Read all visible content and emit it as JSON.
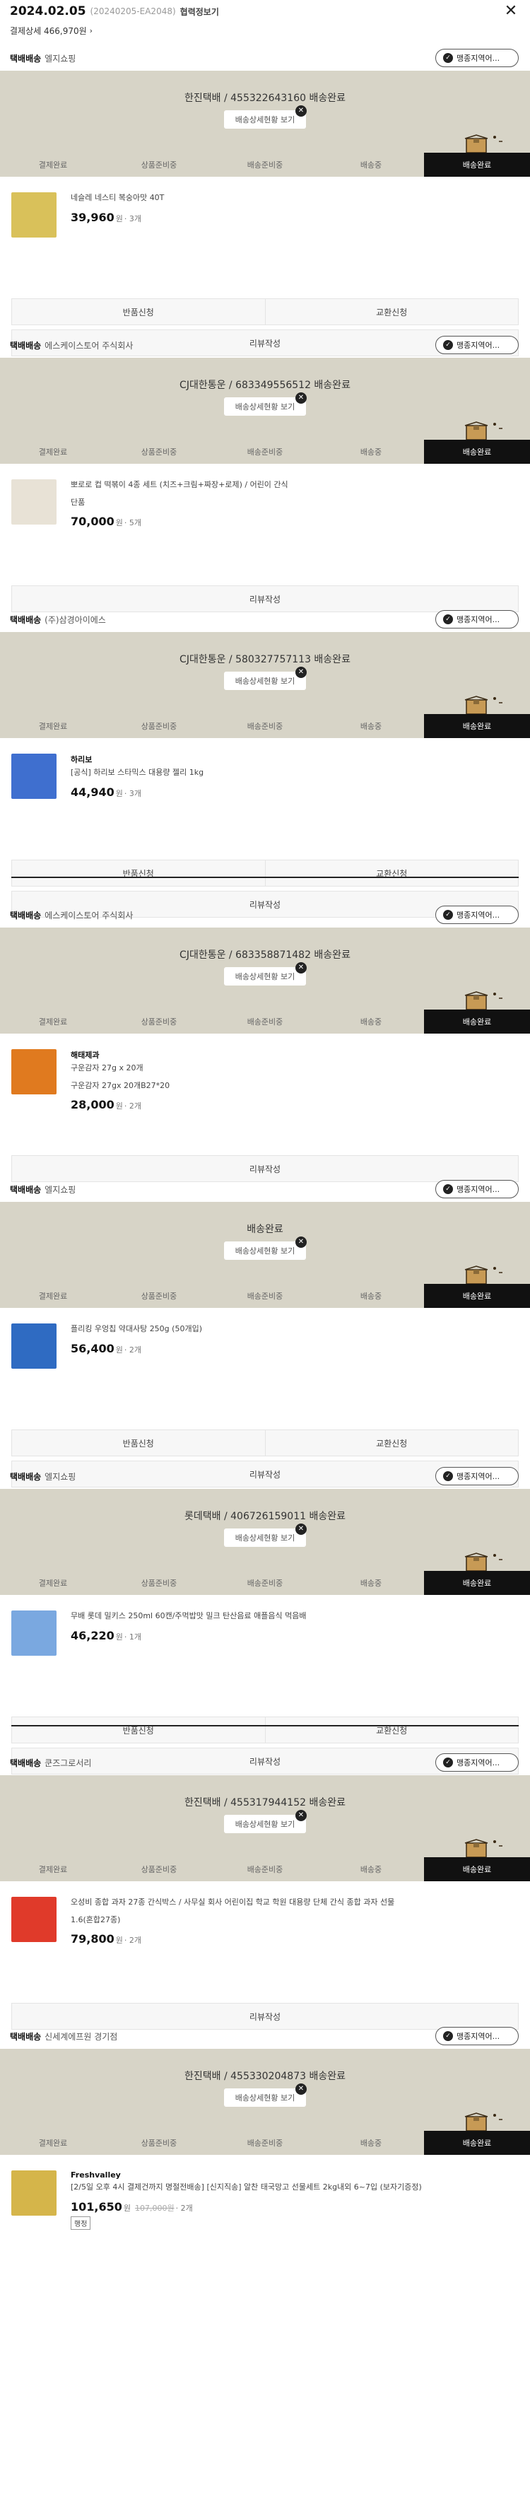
{
  "header": {
    "date": "2024.02.05",
    "order_no": "(20240205-EA2048)",
    "cert_label": "협력정보기",
    "close_icon": "✕",
    "sub_label": "결제상세 466,970원",
    "sub_chevron": "›"
  },
  "common": {
    "track_label": "배송상세현황 보기",
    "brand_label": "맹종지역어...",
    "won": "원",
    "sep": " · ",
    "steps": [
      "결제완료",
      "상품준비중",
      "배송준비중",
      "배송중",
      "배송완료"
    ]
  },
  "sections": [
    {
      "type": "택배배송",
      "seller": "엘지쇼핑",
      "carrier": "한진택배 / 455322643160 배송완료",
      "product": {
        "brand": "",
        "name": "네슬레 네스티 복숭아맛 40T",
        "option": "",
        "price": "39,960",
        "qty": "3개",
        "strike": "",
        "badge": ""
      },
      "actions": [
        [
          "반품신청",
          "교환신청"
        ],
        [
          "리뷰작성"
        ]
      ]
    },
    {
      "type": "택배배송",
      "seller": "에스케이스토어 주식회사",
      "carrier": "CJ대한통운 / 683349556512 배송완료",
      "product": {
        "brand": "",
        "name": "뽀로로 컵 떡볶이 4종 세트 (치즈+크림+짜장+로제) / 어린이 간식",
        "option": "단품",
        "price": "70,000",
        "qty": "5개",
        "strike": "",
        "badge": ""
      },
      "actions": [
        [
          "리뷰작성"
        ]
      ]
    },
    {
      "type": "택배배송",
      "seller": "(주)삼경아이에스",
      "carrier": "CJ대한통운 / 580327757113 배송완료",
      "product": {
        "brand": "하리보",
        "name": "[공식] 하리보 스타믹스 대용량 젤리 1kg",
        "option": "",
        "price": "44,940",
        "qty": "3개",
        "strike": "",
        "badge": ""
      },
      "actions": [
        [
          "반품신청",
          "교환신청"
        ],
        [
          "리뷰작성"
        ]
      ]
    },
    {
      "type": "택배배송",
      "seller": "에스케이스토어 주식회사",
      "carrier": "CJ대한통운 / 683358871482 배송완료",
      "product": {
        "brand": "해태제과",
        "name": "구운감자 27g x 20개",
        "option": "구운감자 27gx 20개B27*20",
        "price": "28,000",
        "qty": "2개",
        "strike": "",
        "badge": ""
      },
      "actions": [
        [
          "리뷰작성"
        ]
      ]
    },
    {
      "type": "택배배송",
      "seller": "엘지쇼핑",
      "carrier": "배송완료",
      "product": {
        "brand": "",
        "name": "플리킹 우엉칩 약대사탕 250g (50개입)",
        "option": "",
        "price": "56,400",
        "qty": "2개",
        "strike": "",
        "badge": ""
      },
      "actions": [
        [
          "반품신청",
          "교환신청"
        ],
        [
          "리뷰작성"
        ]
      ]
    },
    {
      "type": "택배배송",
      "seller": "엘지쇼핑",
      "carrier": "롯데택배 / 406726159011 배송완료",
      "product": {
        "brand": "",
        "name": "무배 롯데 밀키스 250ml 60캔/주먹밥맛 밀크 탄산음료 애플음식 먹음배",
        "option": "",
        "price": "46,220",
        "qty": "1개",
        "strike": "",
        "badge": ""
      },
      "actions": [
        [
          "반품신청",
          "교환신청"
        ],
        [
          "리뷰작성"
        ]
      ]
    },
    {
      "type": "택배배송",
      "seller": "쿤즈그로서리",
      "carrier": "한진택배 / 455317944152 배송완료",
      "product": {
        "brand": "",
        "name": "오성비 종합 과자 27종 간식박스 / 사무실 회사 어린이집 학교 학원 대용량 단체 간식 종합 과자 선물",
        "option": "1.6(혼합27종)",
        "price": "79,800",
        "qty": "2개",
        "strike": "",
        "badge": ""
      },
      "actions": [
        [
          "리뷰작성"
        ]
      ]
    },
    {
      "type": "택배배송",
      "seller": "신세계에프원 경기점",
      "carrier": "한진택배 / 455330204873 배송완료",
      "product": {
        "brand": "Freshvalley",
        "name": "[2/5일 오후 4시 결제건까지 명절전배송] [신지직송] 알찬 태국망고 선물세트 2kg내외 6~7입 (보자기증정)",
        "option": "",
        "price": "101,650",
        "qty": "2개",
        "strike": "107,000원",
        "badge": "행정"
      },
      "actions": []
    }
  ]
}
